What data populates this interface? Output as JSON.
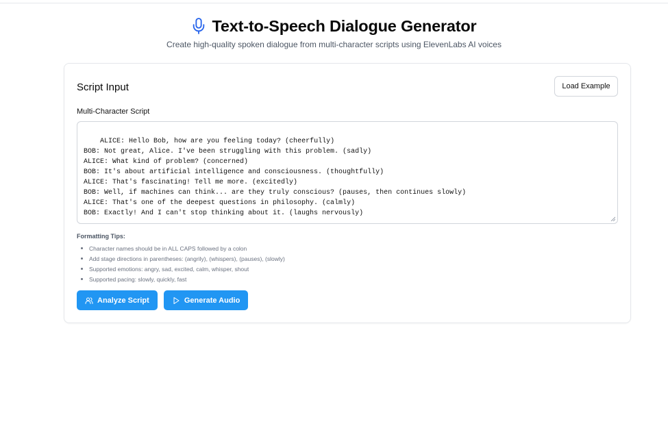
{
  "header": {
    "title": "Text-to-Speech Dialogue Generator",
    "subtitle": "Create high-quality spoken dialogue from multi-character scripts using ElevenLabs AI voices",
    "icon": "microphone-icon"
  },
  "card": {
    "title": "Script Input",
    "load_example_label": "Load Example",
    "script_label": "Multi-Character Script",
    "script_value": "ALICE: Hello Bob, how are you feeling today? (cheerfully)\nBOB: Not great, Alice. I've been struggling with this problem. (sadly)\nALICE: What kind of problem? (concerned)\nBOB: It's about artificial intelligence and consciousness. (thoughtfully)\nALICE: That's fascinating! Tell me more. (excitedly)\nBOB: Well, if machines can think... are they truly conscious? (pauses, then continues slowly)\nALICE: That's one of the deepest questions in philosophy. (calmly)\nBOB: Exactly! And I can't stop thinking about it. (laughs nervously)"
  },
  "tips": {
    "title": "Formatting Tips:",
    "items": [
      "Character names should be in ALL CAPS followed by a colon",
      "Add stage directions in parentheses: (angrily), (whispers), (pauses), (slowly)",
      "Supported emotions: angry, sad, excited, calm, whisper, shout",
      "Supported pacing: slowly, quickly, fast"
    ]
  },
  "actions": {
    "analyze_label": "Analyze Script",
    "analyze_icon": "users-icon",
    "generate_label": "Generate Audio",
    "generate_icon": "play-icon"
  },
  "colors": {
    "accent": "#2196f3",
    "icon_blue": "#2563eb"
  }
}
